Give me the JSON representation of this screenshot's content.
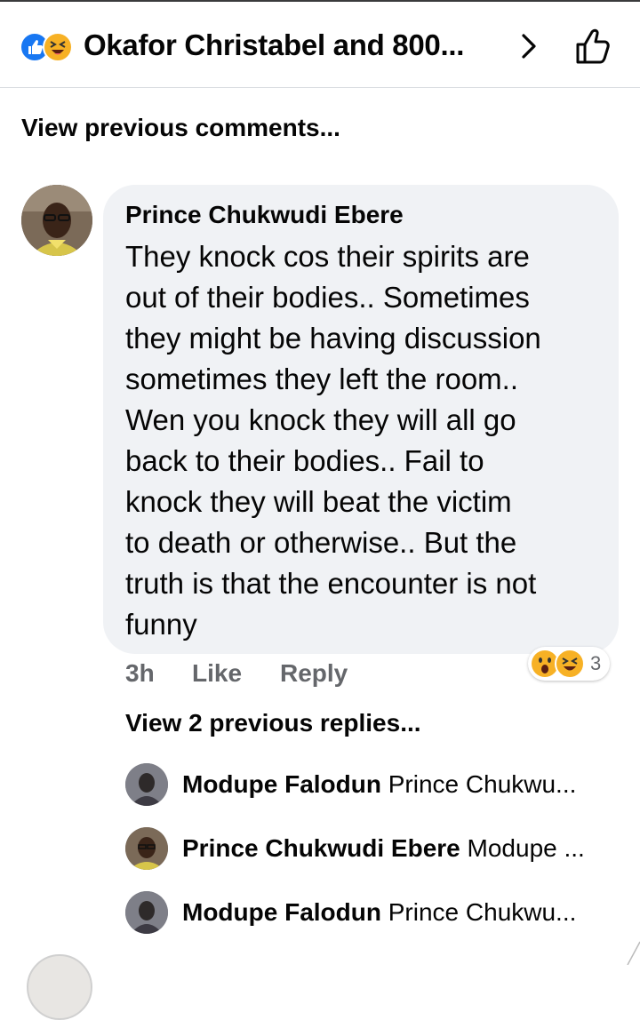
{
  "header": {
    "title": "Okafor Christabel and 800...",
    "reaction_icons": [
      "like-icon",
      "haha-icon"
    ],
    "actions": [
      "chevron-right-icon",
      "thumbs-up-icon"
    ]
  },
  "view_previous_comments": "View previous comments...",
  "comment": {
    "author": "Prince Chukwudi Ebere",
    "text": "They knock cos their spirits are\nout of their bodies.. Sometimes\nthey might be having discussion\nsometimes they left the room..\nWen you knock they will all go\nback to their bodies.. Fail to\nknock they will beat the victim\nto death or otherwise.. But the\ntruth is that the encounter is not\nfunny",
    "time": "3h",
    "like_label": "Like",
    "reply_label": "Reply",
    "reaction_count": "3",
    "reaction_icons": [
      "wow-icon",
      "haha-icon"
    ]
  },
  "replies": {
    "view_label": "View 2 previous replies...",
    "items": [
      {
        "name": "Modupe Falodun",
        "snippet": "Prince Chukwu..."
      },
      {
        "name": "Prince Chukwudi Ebere",
        "snippet": "Modupe ..."
      },
      {
        "name": "Modupe Falodun",
        "snippet": "Prince Chukwu..."
      }
    ]
  },
  "colors": {
    "like_blue": "#1877f2",
    "emoji_yellow": "#f7b125",
    "bubble_bg": "#f0f2f5",
    "meta_gray": "#65676b"
  }
}
